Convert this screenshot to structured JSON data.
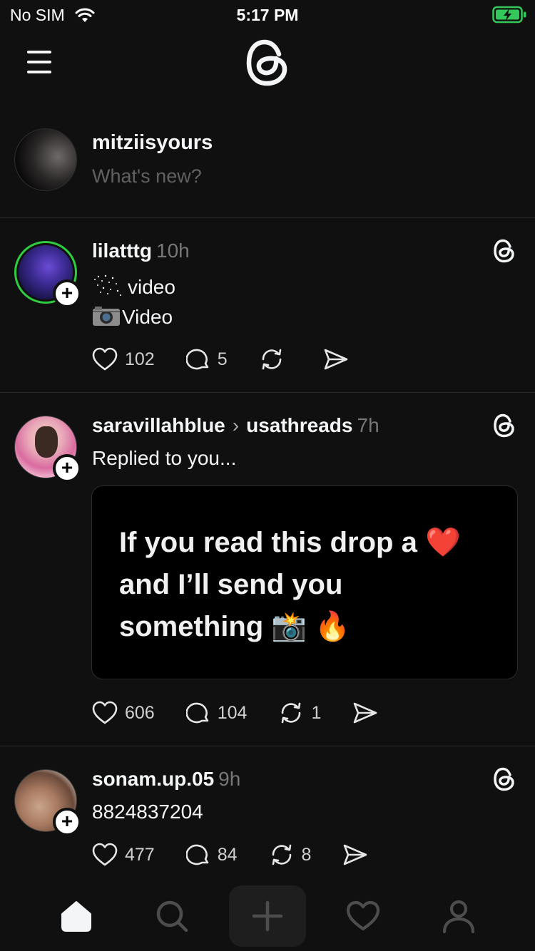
{
  "status_bar": {
    "carrier": "No SIM",
    "time": "5:17 PM",
    "battery_color": "#34c759"
  },
  "header": {
    "menu_icon": "hamburger-icon",
    "logo_icon": "threads-logo"
  },
  "composer": {
    "username": "mitziisyours",
    "placeholder": "What's new?"
  },
  "posts": [
    {
      "username": "lilatttg",
      "time": "10h",
      "lines": [
        "video",
        "Video"
      ],
      "likes": "102",
      "replies": "5",
      "reposts": "",
      "follow_label": "+"
    },
    {
      "username": "saravillahblue",
      "reply_to": "usathreads",
      "time": "7h",
      "text": "Replied to you...",
      "media_lines": [
        "If you read this drop a ❤️",
        "and I’ll send you",
        "something 📸 🔥"
      ],
      "likes": "606",
      "replies": "104",
      "reposts": "1",
      "follow_label": "+"
    },
    {
      "username": "sonam.up.05",
      "time": "9h",
      "text": "8824837204",
      "likes": "477",
      "replies": "84",
      "reposts": "8",
      "follow_label": "+"
    }
  ],
  "nav": {
    "items": [
      "home-icon",
      "search-icon",
      "compose-icon",
      "heart-icon",
      "profile-icon"
    ]
  },
  "colors": {
    "background": "#101010",
    "text": "#f3f5f7",
    "muted": "#777777",
    "divider": "#2b2b2b",
    "story_ring": "#2ecc40"
  }
}
